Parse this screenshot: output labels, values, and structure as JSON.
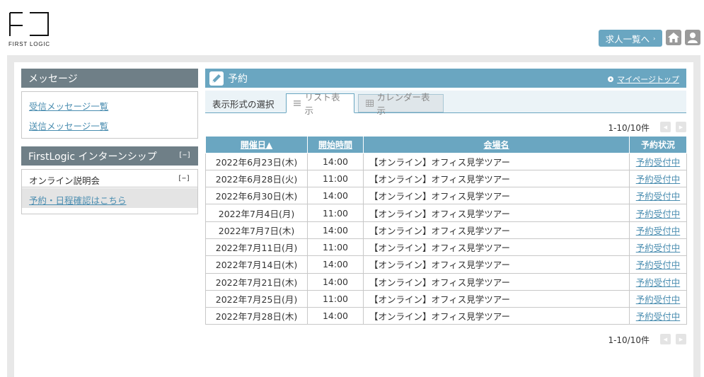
{
  "header": {
    "logo_text": "FIRST LOGIC",
    "jobs_button": "求人一覧へ",
    "arrow": "›"
  },
  "sidebar": {
    "messages": {
      "title": "メッセージ",
      "links": [
        "受信メッセージ一覧",
        "送信メッセージ一覧"
      ]
    },
    "internship": {
      "title": "FirstLogic インターンシップ",
      "collapse": "[−]",
      "section": "オンライン説明会",
      "section_collapse": "[−]",
      "link": "予約・日程確認はこちら"
    }
  },
  "main": {
    "title": "予約",
    "mypage_link": "マイページトップ",
    "view_label": "表示形式の選択",
    "tabs": [
      {
        "label": "リスト表示",
        "active": true
      },
      {
        "label": "カレンダー表示",
        "active": false
      }
    ],
    "pager_text": "1-10/10件",
    "table": {
      "headers": [
        "開催日▲",
        "開始時間",
        "会場名",
        "予約状況"
      ],
      "rows": [
        [
          "2022年6月23日(木)",
          "14:00",
          "【オンライン】オフィス見学ツアー",
          "予約受付中"
        ],
        [
          "2022年6月28日(火)",
          "11:00",
          "【オンライン】オフィス見学ツアー",
          "予約受付中"
        ],
        [
          "2022年6月30日(木)",
          "14:00",
          "【オンライン】オフィス見学ツアー",
          "予約受付中"
        ],
        [
          "2022年7月4日(月)",
          "11:00",
          "【オンライン】オフィス見学ツアー",
          "予約受付中"
        ],
        [
          "2022年7月7日(木)",
          "14:00",
          "【オンライン】オフィス見学ツアー",
          "予約受付中"
        ],
        [
          "2022年7月11日(月)",
          "11:00",
          "【オンライン】オフィス見学ツアー",
          "予約受付中"
        ],
        [
          "2022年7月14日(木)",
          "14:00",
          "【オンライン】オフィス見学ツアー",
          "予約受付中"
        ],
        [
          "2022年7月21日(木)",
          "14:00",
          "【オンライン】オフィス見学ツアー",
          "予約受付中"
        ],
        [
          "2022年7月25日(月)",
          "11:00",
          "【オンライン】オフィス見学ツアー",
          "予約受付中"
        ],
        [
          "2022年7月28日(木)",
          "14:00",
          "【オンライン】オフィス見学ツアー",
          "予約受付中"
        ]
      ]
    }
  },
  "colors": {
    "accent": "#6aa6c1",
    "sidebar_header": "#6f7f87",
    "link": "#4a8db0",
    "frame": "#e8e8e8"
  },
  "icons": {
    "home": "home-icon",
    "user": "user-icon",
    "pen": "pen-icon",
    "list": "list-icon",
    "calendar": "calendar-icon"
  }
}
